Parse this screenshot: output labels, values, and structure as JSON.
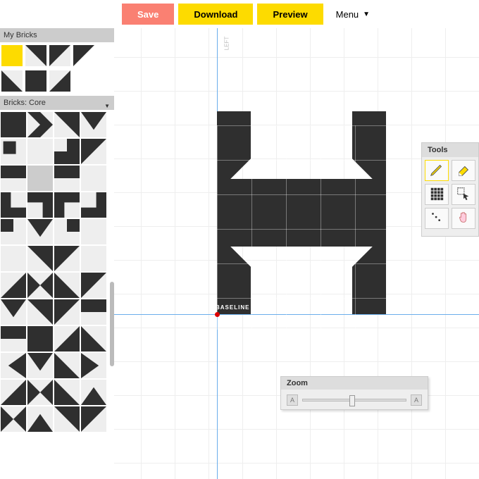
{
  "toolbar": {
    "save_label": "Save",
    "download_label": "Download",
    "preview_label": "Preview",
    "menu_label": "Menu"
  },
  "panels": {
    "my_bricks_title": "My Bricks",
    "core_title": "Bricks: Core",
    "tools_title": "Tools",
    "zoom_title": "Zoom"
  },
  "my_bricks": [
    {
      "type": "square",
      "fill": "#fddb00"
    },
    {
      "type": "diag_tr",
      "fill": "#2f2f2f"
    },
    {
      "type": "diag_tl",
      "fill": "#2f2f2f"
    },
    {
      "type": "diag_tl_w",
      "fill": "#2f2f2f"
    },
    {
      "type": "diag_bl",
      "fill": "#2f2f2f"
    },
    {
      "type": "square",
      "fill": "#2f2f2f"
    },
    {
      "type": "diag_br",
      "fill": "#2f2f2f"
    }
  ],
  "core_bricks": [
    "square",
    "hchev",
    "diag_tr",
    "dn_tri",
    "sq_small",
    "blank",
    "steps",
    "diag_tl",
    "half_top",
    "grey",
    "half_top",
    "blank",
    "L_bl",
    "L_tr",
    "L_tl",
    "L_br",
    "sq_tl",
    "dn_tri",
    "sq_tr",
    "blank",
    "blank",
    "diag_tr",
    "diag_tl",
    "blank",
    "diag_br",
    "tie",
    "diag_bl",
    "diag_tl",
    "dn_tri",
    "diag_tr",
    "diag_tl",
    "half_top",
    "half_top",
    "square",
    "diag_br",
    "diag_bl",
    "tri_rt",
    "dn_tri",
    "diag_bl",
    "tri_lt",
    "diag_br",
    "tie",
    "diag_bl",
    "up_tri",
    "tie",
    "up_tri",
    "diag_tr",
    "diag_tl"
  ],
  "tools": [
    {
      "id": "pencil",
      "active": true
    },
    {
      "id": "eraser",
      "active": false
    },
    {
      "id": "grid",
      "active": false
    },
    {
      "id": "select",
      "active": false
    },
    {
      "id": "dots",
      "active": false
    },
    {
      "id": "pan",
      "active": false
    }
  ],
  "zoom": {
    "min_icon": "−",
    "max_icon": "+",
    "value_pct": 48
  },
  "canvas": {
    "baseline_label": "BASELINE",
    "top_marker": "LEFT",
    "glyph": [
      {
        "r": 0,
        "c": 0,
        "t": "square"
      },
      {
        "r": 0,
        "c": 4,
        "t": "square"
      },
      {
        "r": 1,
        "c": 0,
        "t": "diag_tl"
      },
      {
        "r": 1,
        "c": 4,
        "t": "diag_tr"
      },
      {
        "r": 2,
        "c": 0,
        "t": "square"
      },
      {
        "r": 2,
        "c": 1,
        "t": "square"
      },
      {
        "r": 2,
        "c": 2,
        "t": "square"
      },
      {
        "r": 2,
        "c": 3,
        "t": "square"
      },
      {
        "r": 2,
        "c": 4,
        "t": "square"
      },
      {
        "r": 3,
        "c": 0,
        "t": "square"
      },
      {
        "r": 3,
        "c": 1,
        "t": "square"
      },
      {
        "r": 3,
        "c": 2,
        "t": "square"
      },
      {
        "r": 3,
        "c": 3,
        "t": "square"
      },
      {
        "r": 3,
        "c": 4,
        "t": "square"
      },
      {
        "r": 4,
        "c": 0,
        "t": "diag_bl"
      },
      {
        "r": 4,
        "c": 4,
        "t": "diag_br"
      },
      {
        "r": 5,
        "c": 0,
        "t": "square"
      },
      {
        "r": 5,
        "c": 4,
        "t": "square"
      }
    ]
  },
  "colors": {
    "brick": "#2f2f2f",
    "accent": "#fddb00",
    "pink": "#fa8072"
  }
}
